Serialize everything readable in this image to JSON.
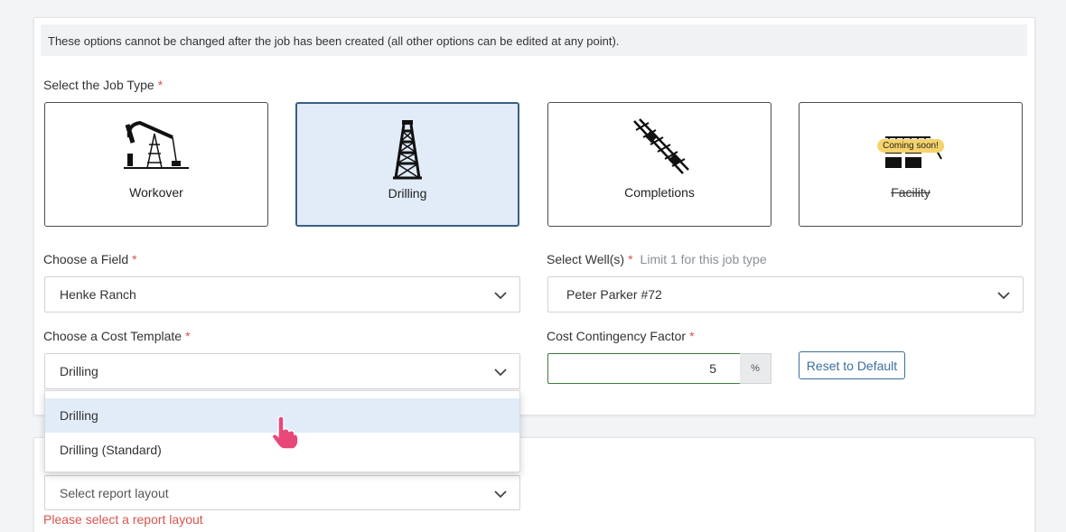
{
  "notice": "These options cannot be changed after the job has been created (all other options can be edited at any point).",
  "job_type": {
    "label": "Select the Job Type",
    "required_mark": "*",
    "options": [
      {
        "label": "Workover",
        "icon": "pumpjack-icon",
        "selected": false,
        "disabled": false
      },
      {
        "label": "Drilling",
        "icon": "drilling-rig-icon",
        "selected": true,
        "disabled": false
      },
      {
        "label": "Completions",
        "icon": "completions-icon",
        "selected": false,
        "disabled": false
      },
      {
        "label": "Facility",
        "icon": "facility-icon",
        "selected": false,
        "disabled": true,
        "badge": "Coming soon!"
      }
    ]
  },
  "field": {
    "label": "Choose a Field",
    "required_mark": "*",
    "value": "Henke Ranch"
  },
  "wells": {
    "label": "Select Well(s)",
    "required_mark": "*",
    "hint": "Limit 1 for this job type",
    "value": "Peter Parker #72"
  },
  "cost_template": {
    "label": "Choose a Cost Template",
    "required_mark": "*",
    "value": "Drilling",
    "options": [
      "Drilling",
      "Drilling (Standard)"
    ]
  },
  "contingency": {
    "label": "Cost Contingency Factor",
    "required_mark": "*",
    "value": "5",
    "unit": "%",
    "reset_label": "Reset to Default"
  },
  "report_layout": {
    "placeholder": "Select report layout",
    "error": "Please select a report layout"
  },
  "colors": {
    "accent": "#3b6f9c",
    "selected_bg": "#e1ecf8",
    "error": "#d9534f",
    "badge": "#f5d36b"
  }
}
